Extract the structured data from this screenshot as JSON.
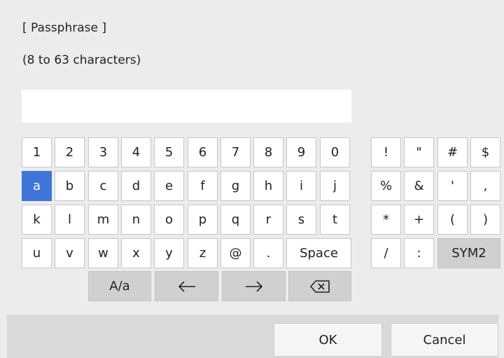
{
  "dialog": {
    "title": "[ Passphrase ]",
    "hint": "(8 to 63 characters)",
    "input_value": ""
  },
  "keyboard": {
    "row1": [
      "1",
      "2",
      "3",
      "4",
      "5",
      "6",
      "7",
      "8",
      "9",
      "0"
    ],
    "row2": [
      "a",
      "b",
      "c",
      "d",
      "e",
      "f",
      "g",
      "h",
      "i",
      "j"
    ],
    "row3": [
      "k",
      "l",
      "m",
      "n",
      "o",
      "p",
      "q",
      "r",
      "s",
      "t"
    ],
    "row4": [
      "u",
      "v",
      "w",
      "x",
      "y",
      "z",
      "@",
      "."
    ],
    "space_label": "Space",
    "case_label": "A/a",
    "selected_key": "a"
  },
  "symbols": {
    "row1": [
      "!",
      "\"",
      "#",
      "$"
    ],
    "row2": [
      "%",
      "&",
      "'",
      ","
    ],
    "row3": [
      "*",
      "+",
      "(",
      ")"
    ],
    "row4": [
      "/",
      ":"
    ],
    "sym2_label": "SYM2"
  },
  "icons": {
    "left_arrow": "left-arrow-icon",
    "right_arrow": "right-arrow-icon",
    "backspace": "backspace-icon"
  },
  "buttons": {
    "ok_label": "OK",
    "cancel_label": "Cancel"
  },
  "colors": {
    "selected_key": "#3f74d8",
    "background": "#ececec"
  }
}
